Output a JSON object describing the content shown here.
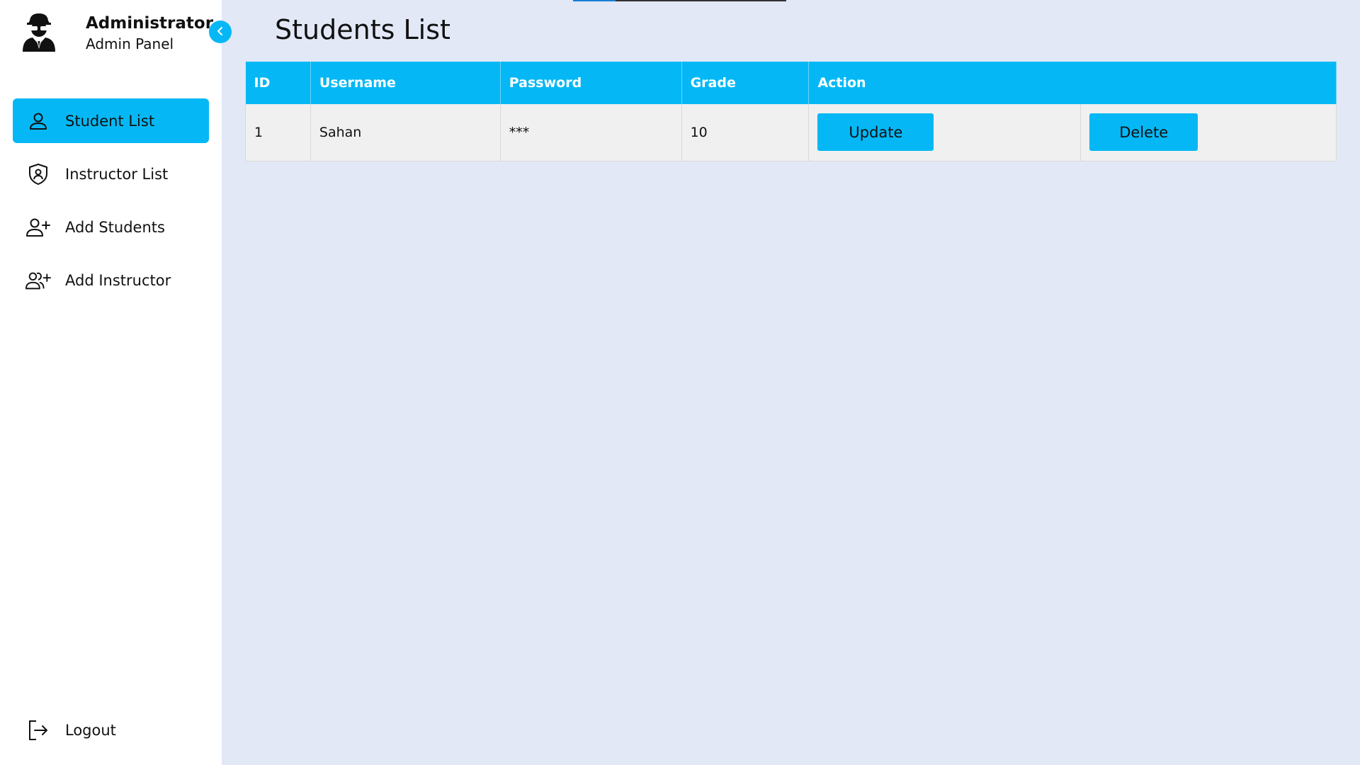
{
  "profile": {
    "role": "Administrator",
    "subtitle": "Admin Panel",
    "avatar_icon": "user-secret-icon"
  },
  "sidebar": {
    "items": [
      {
        "label": "Student List",
        "icon": "user-icon",
        "active": true
      },
      {
        "label": "Instructor List",
        "icon": "shield-user-icon",
        "active": false
      },
      {
        "label": "Add Students",
        "icon": "user-plus-icon",
        "active": false
      },
      {
        "label": "Add Instructor",
        "icon": "users-plus-icon",
        "active": false
      }
    ],
    "logout_label": "Logout"
  },
  "page": {
    "title": "Students List"
  },
  "table": {
    "headers": [
      "ID",
      "Username",
      "Password",
      "Grade",
      "Action"
    ],
    "rows": [
      {
        "id": "1",
        "username": "Sahan",
        "password": "***",
        "grade": "10",
        "update_label": "Update",
        "delete_label": "Delete"
      }
    ]
  },
  "colors": {
    "accent": "#05b8f5",
    "background": "#e2e8f6",
    "sidebar": "#ffffff",
    "row": "#f0f0f0"
  }
}
